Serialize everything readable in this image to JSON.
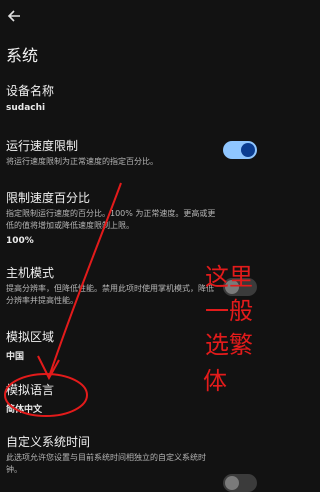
{
  "header": {
    "title": "系统",
    "back_icon": "arrow-left-icon"
  },
  "settings": {
    "device_name": {
      "title": "设备名称",
      "value": "sudachi"
    },
    "speed_limit": {
      "title": "运行速度限制",
      "desc": "将运行速度限制为正常速度的指定百分比。",
      "enabled": true
    },
    "speed_percent": {
      "title": "限制速度百分比",
      "desc": "指定限制运行速度的百分比。100% 为正常速度。更高或更低的值将增加或降低速度限制上限。",
      "value": "100%"
    },
    "handheld_mode": {
      "title": "主机模式",
      "desc": "提高分辨率，但降低性能。禁用此项时使用掌机模式，降低分辨率并提高性能。",
      "enabled": false
    },
    "region": {
      "title": "模拟区域",
      "value": "中国"
    },
    "language": {
      "title": "模拟语言",
      "value": "简体中文"
    },
    "custom_time": {
      "title": "自定义系统时间",
      "desc": "此选项允许您设置与目前系统时间相独立的自定义系统时钟。",
      "enabled": false
    }
  },
  "annotation": {
    "lines": [
      "这里",
      "一般",
      "选繁",
      "体"
    ],
    "color": "#e31b1b"
  },
  "colors": {
    "background": "#121212",
    "toggle_on_track": "#8fc6ff",
    "toggle_on_knob": "#0b3d91"
  }
}
